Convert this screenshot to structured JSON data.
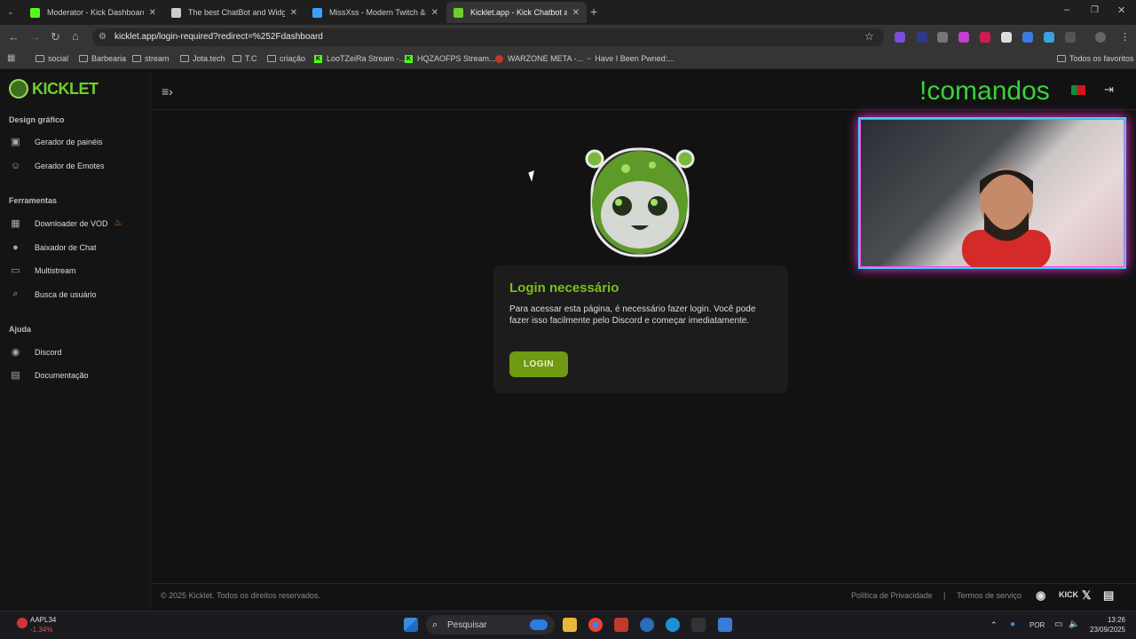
{
  "browser": {
    "tabs": [
      {
        "title": "Moderator - Kick Dashboard",
        "active": false,
        "fav_color": "#53fc18"
      },
      {
        "title": "The best ChatBot and Widgets",
        "active": false,
        "fav_color": "#cccccc"
      },
      {
        "title": "MissXss - Modern Twitch & Ki",
        "active": false,
        "fav_color": "#3aa0ff"
      },
      {
        "title": "Kicklet.app - Kick Chatbot and",
        "active": true,
        "fav_color": "#6fcf2a"
      }
    ],
    "url": "kicklet.app/login-required?redirect=%252Fdashboard",
    "bookmarks": [
      {
        "label": "social",
        "icon": "folder-icon"
      },
      {
        "label": "Barbearia",
        "icon": "folder-icon"
      },
      {
        "label": "stream",
        "icon": "folder-icon"
      },
      {
        "label": "Jota.tech",
        "icon": "folder-icon"
      },
      {
        "label": "T.C",
        "icon": "folder-icon"
      },
      {
        "label": "criação",
        "icon": "folder-icon"
      },
      {
        "label": "LooTZeiRa Stream -...",
        "icon": "kick-icon"
      },
      {
        "label": "HQZAOFPS Stream...",
        "icon": "kick-icon"
      },
      {
        "label": "WARZONE META -...",
        "icon": "warzone-icon"
      },
      {
        "label": "Have I Been Pwned:...",
        "icon": "pwned-icon"
      }
    ],
    "all_bookmarks": "Todos os favoritos"
  },
  "sidebar": {
    "logo": "KICKLET",
    "sections": [
      {
        "title": "Design gráfico",
        "items": [
          {
            "label": "Gerador de painéis",
            "icon": "panel-icon"
          },
          {
            "label": "Gerador de Emotes",
            "icon": "emote-icon"
          }
        ]
      },
      {
        "title": "Ferramentas",
        "items": [
          {
            "label": "Downloader de VOD",
            "icon": "film-icon",
            "badge": "fire-icon"
          },
          {
            "label": "Baixador de Chat",
            "icon": "chat-icon"
          },
          {
            "label": "Multistream",
            "icon": "monitor-icon"
          },
          {
            "label": "Busca de usuário",
            "icon": "search-icon"
          }
        ]
      },
      {
        "title": "Ajuda",
        "items": [
          {
            "label": "Discord",
            "icon": "discord-icon"
          },
          {
            "label": "Documentação",
            "icon": "docs-icon"
          }
        ]
      }
    ]
  },
  "overlay": {
    "comandos": "!comandos"
  },
  "card": {
    "title": "Login necessário",
    "text": "Para acessar esta página, é necessário fazer login. Você pode fazer isso facilmente pelo Discord e começar imediatamente.",
    "button": "LOGIN"
  },
  "footer": {
    "copyright": "© 2025 Kicklet. Todos os direitos reservados.",
    "privacy": "Política de Privacidade",
    "separator": "|",
    "terms": "Termos de serviço",
    "kick": "KICK"
  },
  "taskbar": {
    "stock_symbol": "AAPL34",
    "stock_change": "-1,34%",
    "search": "Pesquisar",
    "lang": "POR",
    "time": "13:26",
    "date": "23/09/2025"
  },
  "colors": {
    "accent": "#6fcf2a",
    "button": "#6f9a13",
    "comandos": "#3bd13b"
  }
}
